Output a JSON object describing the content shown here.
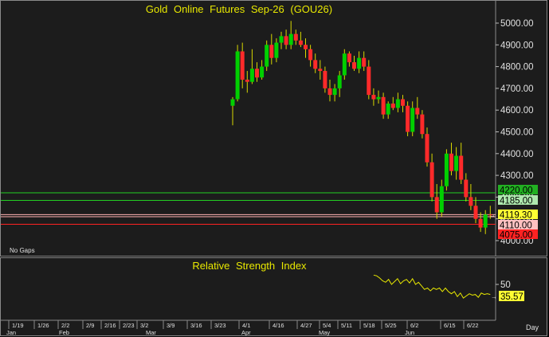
{
  "chart_data": [
    {
      "type": "candlestick",
      "title": "Gold Online Futures Sep-26 (GOU26)",
      "note": "No Gaps",
      "ylim": [
        3985,
        5040
      ],
      "y_ticks": [
        4000,
        4100,
        4200,
        4300,
        4400,
        4500,
        4600,
        4700,
        4800,
        4900,
        5000
      ],
      "y_tick_labels": [
        "4000.00",
        "4100.00",
        "4200.00",
        "4300.00",
        "4400.00",
        "4500.00",
        "4600.00",
        "4700.00",
        "4800.00",
        "4900.00",
        "5000.00"
      ],
      "colors": {
        "up": "#00d000",
        "down": "#ff2a2a",
        "wick": "#d8d800"
      },
      "levels": [
        {
          "value": 4220.0,
          "label": "4220.00",
          "line": "#22d022",
          "box": "#22b022",
          "text": "#000000"
        },
        {
          "value": 4185.0,
          "label": "4185.00",
          "line": "#22d022",
          "box": "#aee8ae",
          "text": "#000000"
        },
        {
          "value": 4119.3,
          "label": "4119.30",
          "line": "#ffb0b0",
          "box": "#ffff33",
          "text": "#000000"
        },
        {
          "value": 4110.0,
          "label": "4110.00",
          "line": "#ffb0b0",
          "box": "#ffc0c0",
          "text": "#000000"
        },
        {
          "value": 4075.0,
          "label": "4075.00",
          "line": "#ff2222",
          "box": "#ff2222",
          "text": "#000000"
        }
      ],
      "candles": [
        [
          0,
          4620,
          4660,
          4530,
          4650
        ],
        [
          1,
          4650,
          4900,
          4640,
          4870
        ],
        [
          2,
          4870,
          4910,
          4700,
          4740
        ],
        [
          3,
          4740,
          4780,
          4680,
          4730
        ],
        [
          4,
          4730,
          4880,
          4720,
          4790
        ],
        [
          5,
          4790,
          4820,
          4730,
          4750
        ],
        [
          6,
          4750,
          4830,
          4740,
          4800
        ],
        [
          7,
          4800,
          4920,
          4780,
          4900
        ],
        [
          8,
          4900,
          4950,
          4810,
          4840
        ],
        [
          9,
          4840,
          4930,
          4820,
          4910
        ],
        [
          10,
          4910,
          4960,
          4880,
          4940
        ],
        [
          11,
          4940,
          4970,
          4880,
          4900
        ],
        [
          12,
          4900,
          5010,
          4880,
          4950
        ],
        [
          13,
          4950,
          4970,
          4900,
          4920
        ],
        [
          14,
          4920,
          4960,
          4890,
          4900
        ],
        [
          15,
          4900,
          4930,
          4840,
          4880
        ],
        [
          16,
          4880,
          4900,
          4800,
          4830
        ],
        [
          17,
          4830,
          4860,
          4770,
          4790
        ],
        [
          18,
          4790,
          4830,
          4740,
          4780
        ],
        [
          19,
          4780,
          4800,
          4680,
          4700
        ],
        [
          20,
          4700,
          4740,
          4640,
          4670
        ],
        [
          21,
          4670,
          4720,
          4640,
          4700
        ],
        [
          22,
          4700,
          4780,
          4660,
          4760
        ],
        [
          23,
          4760,
          4880,
          4740,
          4860
        ],
        [
          24,
          4860,
          4870,
          4800,
          4820
        ],
        [
          25,
          4820,
          4850,
          4780,
          4790
        ],
        [
          26,
          4790,
          4870,
          4770,
          4840
        ],
        [
          27,
          4840,
          4870,
          4780,
          4800
        ],
        [
          28,
          4800,
          4830,
          4650,
          4670
        ],
        [
          29,
          4670,
          4700,
          4620,
          4650
        ],
        [
          30,
          4650,
          4690,
          4630,
          4660
        ],
        [
          31,
          4660,
          4680,
          4560,
          4580
        ],
        [
          32,
          4580,
          4640,
          4560,
          4630
        ],
        [
          33,
          4630,
          4660,
          4600,
          4610
        ],
        [
          34,
          4610,
          4680,
          4590,
          4650
        ],
        [
          35,
          4650,
          4670,
          4590,
          4620
        ],
        [
          36,
          4620,
          4640,
          4480,
          4500
        ],
        [
          37,
          4500,
          4640,
          4480,
          4610
        ],
        [
          38,
          4610,
          4660,
          4560,
          4580
        ],
        [
          39,
          4580,
          4600,
          4470,
          4490
        ],
        [
          40,
          4490,
          4520,
          4340,
          4360
        ],
        [
          41,
          4360,
          4400,
          4180,
          4200
        ],
        [
          42,
          4200,
          4260,
          4100,
          4130
        ],
        [
          43,
          4130,
          4280,
          4110,
          4250
        ],
        [
          44,
          4250,
          4420,
          4230,
          4400
        ],
        [
          45,
          4400,
          4450,
          4300,
          4320
        ],
        [
          46,
          4320,
          4430,
          4280,
          4390
        ],
        [
          47,
          4390,
          4450,
          4260,
          4280
        ],
        [
          48,
          4280,
          4310,
          4180,
          4200
        ],
        [
          49,
          4200,
          4260,
          4140,
          4160
        ],
        [
          50,
          4160,
          4200,
          4080,
          4100
        ],
        [
          51,
          4100,
          4130,
          4040,
          4060
        ],
        [
          52,
          4060,
          4140,
          4030,
          4120
        ],
        [
          53,
          4120,
          4160,
          4100,
          4119
        ]
      ],
      "x_tick_labels": [
        "1/19",
        "1/26",
        "2/2",
        "2/9",
        "2/16",
        "2/23",
        "3/2",
        "3/9",
        "3/16",
        "3/23",
        "4/1",
        "4/16",
        "4/27",
        "5/4",
        "5/11",
        "5/18",
        "5/25",
        "6/2",
        "6/15",
        "6/22"
      ],
      "month_labels": [
        "Jan",
        "Feb",
        "Mar",
        "Apr",
        "May",
        "Jun"
      ],
      "period_label": "Day"
    },
    {
      "type": "line",
      "title": "Relative Strength Index",
      "ylim": [
        0,
        100
      ],
      "y_ticks": [
        50
      ],
      "y_tick_labels": [
        "50"
      ],
      "current_label": "35.57",
      "line_color": "#e8e800",
      "start_index": 29,
      "values": [
        63,
        62,
        59,
        55,
        53,
        57,
        50,
        54,
        58,
        51,
        55,
        57,
        52,
        58,
        50,
        53,
        48,
        43,
        45,
        41,
        45,
        43,
        45,
        40,
        45,
        40,
        37,
        40,
        33,
        38,
        31,
        34,
        37,
        35,
        36,
        32,
        38,
        36,
        37,
        36
      ]
    }
  ]
}
